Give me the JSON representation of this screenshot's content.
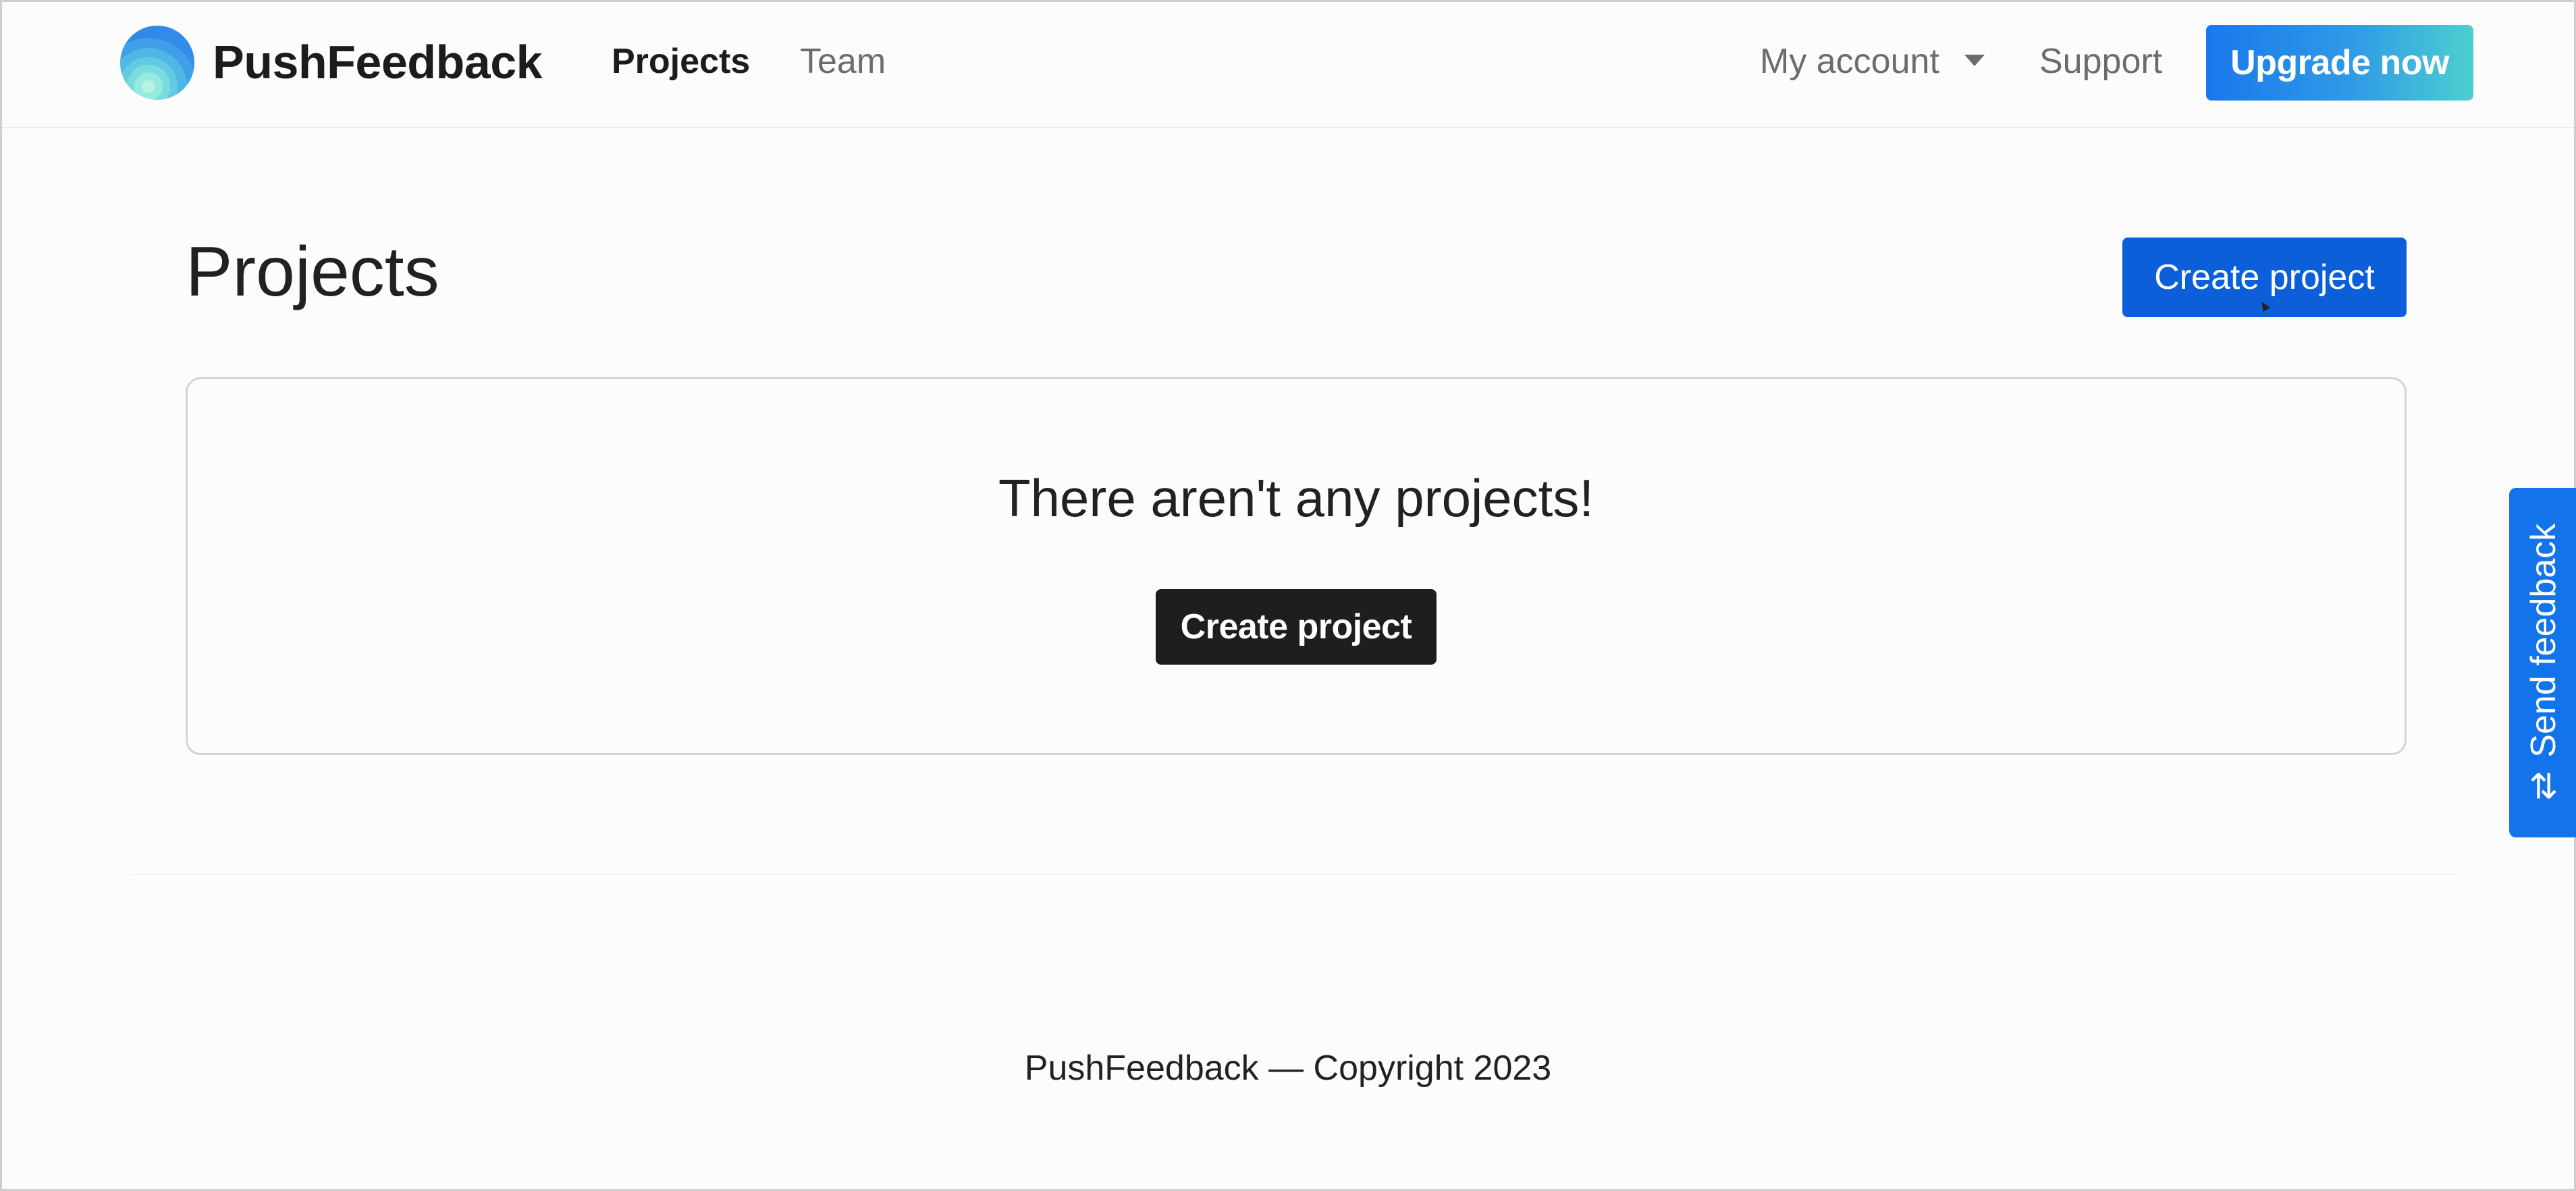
{
  "brand": {
    "name": "PushFeedback",
    "logo_icon": "gradient-circle-logo-icon"
  },
  "nav": {
    "projects": "Projects",
    "team": "Team",
    "my_account": "My account",
    "support": "Support",
    "upgrade": "Upgrade now",
    "active_item": "Projects"
  },
  "main": {
    "title": "Projects",
    "create_button": "Create project",
    "empty_message": "There aren't any projects!",
    "empty_create_button": "Create project"
  },
  "footer": {
    "text": "PushFeedback — Copyright 2023"
  },
  "feedback_tab": {
    "label": "Send feedback",
    "icon": "swap-arrows-icon"
  },
  "colors": {
    "primary": "#0c5fd8",
    "upgrade_gradient_start": "#1a78ec",
    "upgrade_gradient_end": "#4ecfd0",
    "dark_button": "#1e1e1e",
    "feedback_tab": "#1273ea",
    "background": "#fcfcfc",
    "text": "#212121",
    "muted_text": "#6c6c6c"
  }
}
